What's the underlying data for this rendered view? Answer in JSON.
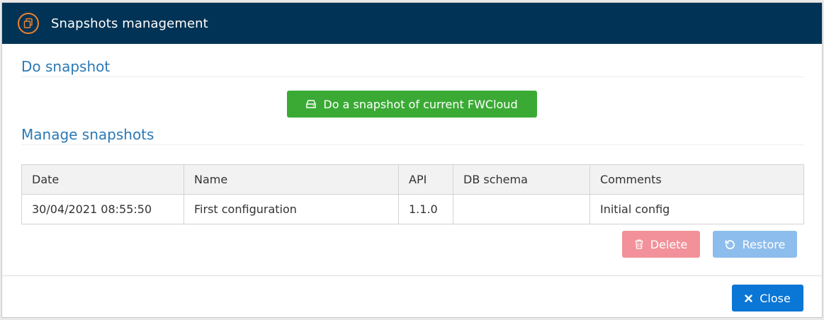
{
  "modal": {
    "title": "Snapshots management",
    "icon": "copy-icon"
  },
  "do_snapshot": {
    "section_title": "Do snapshot",
    "button_label": "Do a snapshot of current FWCloud",
    "button_icon": "hdd-icon"
  },
  "manage": {
    "section_title": "Manage snapshots",
    "columns": [
      "Date",
      "Name",
      "API",
      "DB schema",
      "Comments"
    ],
    "rows": [
      [
        "30/04/2021 08:55:50",
        "First configuration",
        "1.1.0",
        "",
        "Initial config"
      ]
    ],
    "delete_label": "Delete",
    "delete_icon": "trash-icon",
    "restore_label": "Restore",
    "restore_icon": "undo-icon"
  },
  "footer": {
    "close_label": "Close",
    "close_icon": "times-icon"
  },
  "colors": {
    "header_bg": "#003355",
    "accent_orange": "#f0822a",
    "section_title": "#2b79b5",
    "success": "#3aaa35",
    "danger_disabled": "#f29199",
    "info_disabled": "#8dbdec",
    "primary": "#0a76d6"
  }
}
